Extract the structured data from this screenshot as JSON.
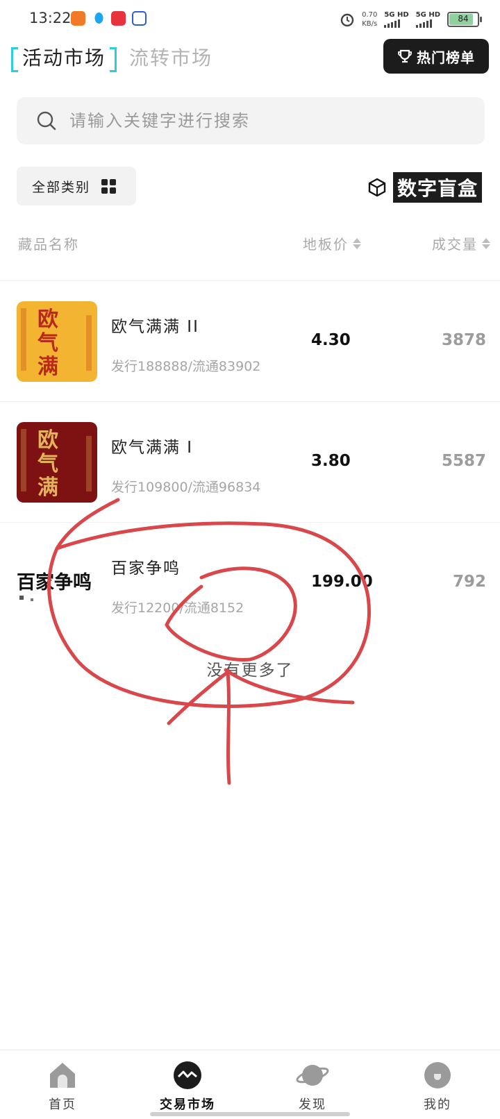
{
  "status_bar": {
    "time": "13:22",
    "net_speed_value": "0.70",
    "net_speed_unit": "KB/s",
    "sim1": "5G HD",
    "sim2": "5G HD",
    "battery": "84"
  },
  "header": {
    "tab_active": "活动市场",
    "tab_inactive": "流转市场",
    "hot_button": "热门榜单"
  },
  "search": {
    "placeholder": "请输入关键字进行搜索"
  },
  "filter": {
    "category_label": "全部类别",
    "blind_box_label": "数字盲盒"
  },
  "table_header": {
    "name": "藏品名称",
    "floor_price": "地板价",
    "volume": "成交量"
  },
  "items": [
    {
      "name": "欧气满满 II",
      "supply": "发行188888/流通83902",
      "price": "4.30",
      "volume": "3878",
      "thumb_color": "#f2b431"
    },
    {
      "name": "欧气满满 I",
      "supply": "发行109800/流通96834",
      "price": "3.80",
      "volume": "5587",
      "thumb_color": "#7e1212"
    },
    {
      "name": "百家争鸣",
      "supply": "发行12200/流通8152",
      "price": "199.00",
      "volume": "792",
      "thumb_color": "#ffffff"
    }
  ],
  "list_end_text": "没有更多了",
  "bottom_nav": [
    {
      "label": "首页",
      "icon": "home-icon"
    },
    {
      "label": "交易市场",
      "icon": "market-icon"
    },
    {
      "label": "发现",
      "icon": "planet-icon"
    },
    {
      "label": "我的",
      "icon": "profile-icon"
    }
  ],
  "colors": {
    "accent": "#2ccfd6",
    "annotation": "#d9474b"
  }
}
